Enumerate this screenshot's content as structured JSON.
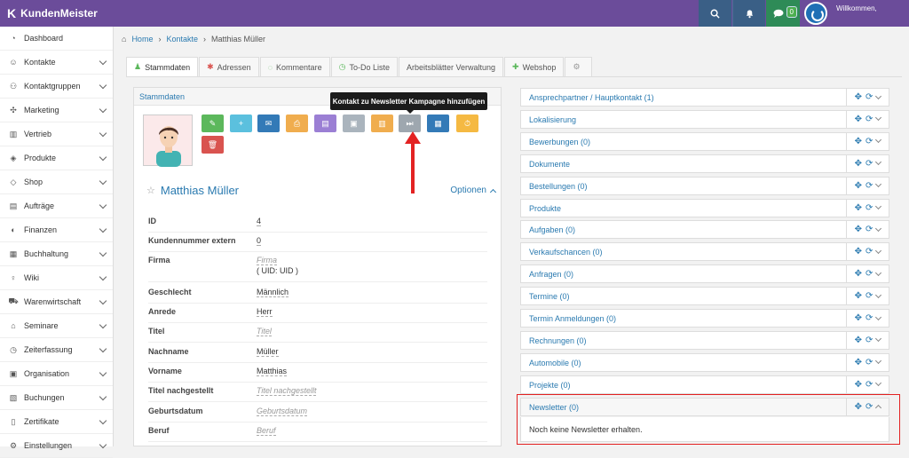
{
  "app": {
    "title": "KundenMeister",
    "welcome": "Willkommen,",
    "chat_badge": "0"
  },
  "sidebar": {
    "items": [
      {
        "label": "Dashboard",
        "icon": "dashboard-icon",
        "chevron": false
      },
      {
        "label": "Kontakte",
        "icon": "contacts-icon",
        "chevron": true
      },
      {
        "label": "Kontaktgruppen",
        "icon": "contact-groups-icon",
        "chevron": true
      },
      {
        "label": "Marketing",
        "icon": "marketing-icon",
        "chevron": true
      },
      {
        "label": "Vertrieb",
        "icon": "sales-icon",
        "chevron": true
      },
      {
        "label": "Produkte",
        "icon": "products-icon",
        "chevron": true
      },
      {
        "label": "Shop",
        "icon": "shop-icon",
        "chevron": true
      },
      {
        "label": "Aufträge",
        "icon": "orders-icon",
        "chevron": true
      },
      {
        "label": "Finanzen",
        "icon": "finance-icon",
        "chevron": true
      },
      {
        "label": "Buchhaltung",
        "icon": "accounting-icon",
        "chevron": true
      },
      {
        "label": "Wiki",
        "icon": "wiki-icon",
        "chevron": true
      },
      {
        "label": "Warenwirtschaft",
        "icon": "inventory-icon",
        "chevron": true
      },
      {
        "label": "Seminare",
        "icon": "seminars-icon",
        "chevron": true
      },
      {
        "label": "Zeiterfassung",
        "icon": "time-tracking-icon",
        "chevron": true
      },
      {
        "label": "Organisation",
        "icon": "organisation-icon",
        "chevron": true
      },
      {
        "label": "Buchungen",
        "icon": "bookings-icon",
        "chevron": true
      },
      {
        "label": "Zertifikate",
        "icon": "certificates-icon",
        "chevron": true
      },
      {
        "label": "Einstellungen",
        "icon": "settings-icon",
        "chevron": true
      }
    ]
  },
  "breadcrumb": {
    "home": "Home",
    "contacts": "Kontakte",
    "current": "Matthias Müller"
  },
  "tabs": [
    {
      "label": "Stammdaten",
      "icon": "user-icon",
      "active": true
    },
    {
      "label": "Adressen",
      "icon": "asterisk-icon",
      "active": false
    },
    {
      "label": "Kommentare",
      "icon": "comment-icon",
      "active": false
    },
    {
      "label": "To-Do Liste",
      "icon": "clock-icon",
      "active": false
    },
    {
      "label": "Arbeitsblätter Verwaltung",
      "icon": "",
      "active": false
    },
    {
      "label": "Webshop",
      "icon": "plus-icon",
      "active": false
    },
    {
      "label": "",
      "icon": "gear-icon",
      "active": false
    }
  ],
  "left_panel": {
    "title": "Stammdaten",
    "tooltip": "Kontakt zu Newsletter Kampagne hinzufügen",
    "contact_name": "Matthias Müller",
    "options_label": "Optionen",
    "buttons": [
      {
        "name": "edit",
        "color": "#5cb85c",
        "glyph": "✎"
      },
      {
        "name": "add",
        "color": "#5bc0de",
        "glyph": "+"
      },
      {
        "name": "email",
        "color": "#337ab7",
        "glyph": "✉"
      },
      {
        "name": "print",
        "color": "#f0ad4e",
        "glyph": "⎙"
      },
      {
        "name": "document",
        "color": "#9b7fd4",
        "glyph": "▤"
      },
      {
        "name": "image",
        "color": "#aab4bd",
        "glyph": "▣"
      },
      {
        "name": "save",
        "color": "#f0ad4e",
        "glyph": "▥"
      },
      {
        "name": "newsletter",
        "color": "#9ea7af",
        "glyph": "⏭"
      },
      {
        "name": "invoice",
        "color": "#337ab7",
        "glyph": "▦"
      },
      {
        "name": "timer",
        "color": "#f5b942",
        "glyph": "⏱"
      },
      {
        "name": "delete",
        "color": "#d9534f",
        "glyph": "🗑"
      }
    ],
    "fields": [
      {
        "label": "ID",
        "value": "4",
        "placeholder": false
      },
      {
        "label": "Kundennummer extern",
        "value": "0",
        "placeholder": false
      },
      {
        "label": "Firma",
        "value": "Firma",
        "value2": "( UID: UID )",
        "placeholder": true
      },
      {
        "label": "Geschlecht",
        "value": "Männlich",
        "placeholder": false
      },
      {
        "label": "Anrede",
        "value": "Herr",
        "placeholder": false
      },
      {
        "label": "Titel",
        "value": "Titel",
        "placeholder": true
      },
      {
        "label": "Nachname",
        "value": "Müller",
        "placeholder": false
      },
      {
        "label": "Vorname",
        "value": "Matthias",
        "placeholder": false
      },
      {
        "label": "Titel nachgestellt",
        "value": "Titel nachgestellt",
        "placeholder": true
      },
      {
        "label": "Geburtsdatum",
        "value": "Geburtsdatum",
        "placeholder": true
      },
      {
        "label": "Beruf",
        "value": "Beruf",
        "placeholder": true
      }
    ]
  },
  "right_panels": [
    {
      "label": "Ansprechpartner / Hauptkontakt (1)"
    },
    {
      "label": "Lokalisierung"
    },
    {
      "label": "Bewerbungen (0)"
    },
    {
      "label": "Dokumente"
    },
    {
      "label": "Bestellungen (0)"
    },
    {
      "label": "Produkte"
    },
    {
      "label": "Aufgaben (0)"
    },
    {
      "label": "Verkaufschancen (0)"
    },
    {
      "label": "Anfragen (0)"
    },
    {
      "label": "Termine (0)"
    },
    {
      "label": "Termin Anmeldungen (0)"
    },
    {
      "label": "Rechnungen (0)"
    },
    {
      "label": "Automobile (0)"
    },
    {
      "label": "Projekte (0)"
    },
    {
      "label": "Newsletter (0)"
    }
  ],
  "newsletter_body": "Noch keine Newsletter erhalten."
}
